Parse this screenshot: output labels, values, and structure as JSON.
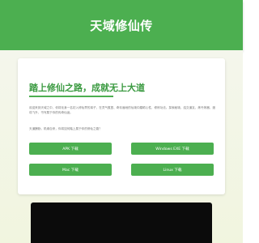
{
  "header": {
    "title": "天域修仙传"
  },
  "hero": {
    "headline": "踏上修仙之路，成就无上大道",
    "intro": "欢迎来到天域之中，你将化身一名初入修仙界的弟子，在灵气氤氲、奇珍遍地的仙境中磨砺心性、修炼功法。探索秘境，结交道友，炼丹炼器，渡劫飞升，书写属于你的传奇仙途。",
    "invite": "天道酬勤，机缘自来，你将如何踏上属于你的修仙之路？"
  },
  "downloads": {
    "apk": "APK 下载",
    "windows": "Windows EXE 下载",
    "mac": "Mac 下载",
    "linux": "Linux 下载"
  },
  "colors": {
    "brand": "#4caf50",
    "headline": "#3a9a40",
    "video_bg": "#0b0b0b"
  }
}
